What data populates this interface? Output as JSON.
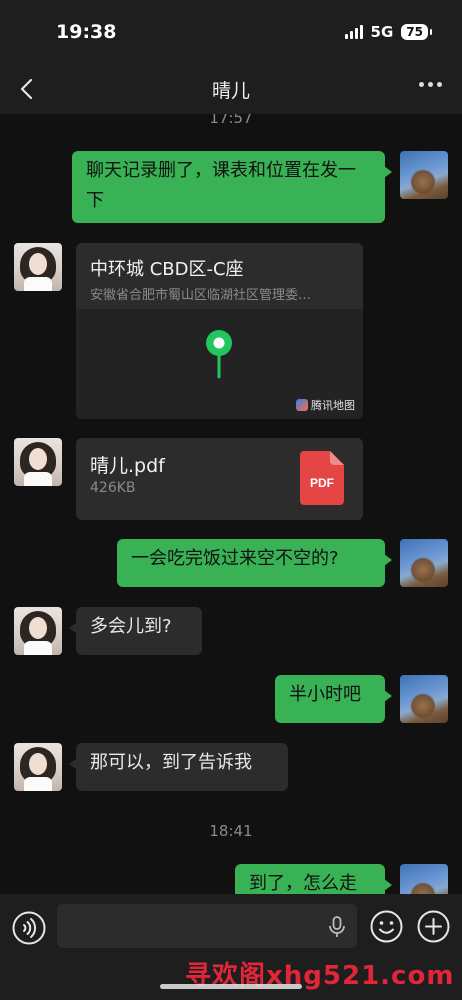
{
  "status_bar": {
    "time": "19:38",
    "network": "5G",
    "battery": "75"
  },
  "header": {
    "title": "晴儿"
  },
  "messages": {
    "timestamp_top": "17:57",
    "msg1": "聊天记录删了，课表和位置在发一下",
    "location": {
      "title": "中环城 CBD区-C座",
      "address": "安徽省合肥市蜀山区临湖社区管理委…",
      "map_brand": "腾讯地图"
    },
    "file": {
      "name": "晴儿.pdf",
      "size": "426KB",
      "type_label": "PDF"
    },
    "msg2": "一会吃完饭过来空不空的?",
    "msg3": "多会儿到?",
    "msg4": "半小时吧",
    "msg5": "那可以，到了告诉我",
    "timestamp_2": "18:41",
    "msg6": "到了，怎么走"
  },
  "input": {
    "placeholder": ""
  },
  "watermark": "寻欢阁xhg521.com",
  "colors": {
    "bubble_green": "#39b255",
    "bubble_gray": "#2c2c2c",
    "background": "#111111",
    "watermark": "#e2263a"
  }
}
